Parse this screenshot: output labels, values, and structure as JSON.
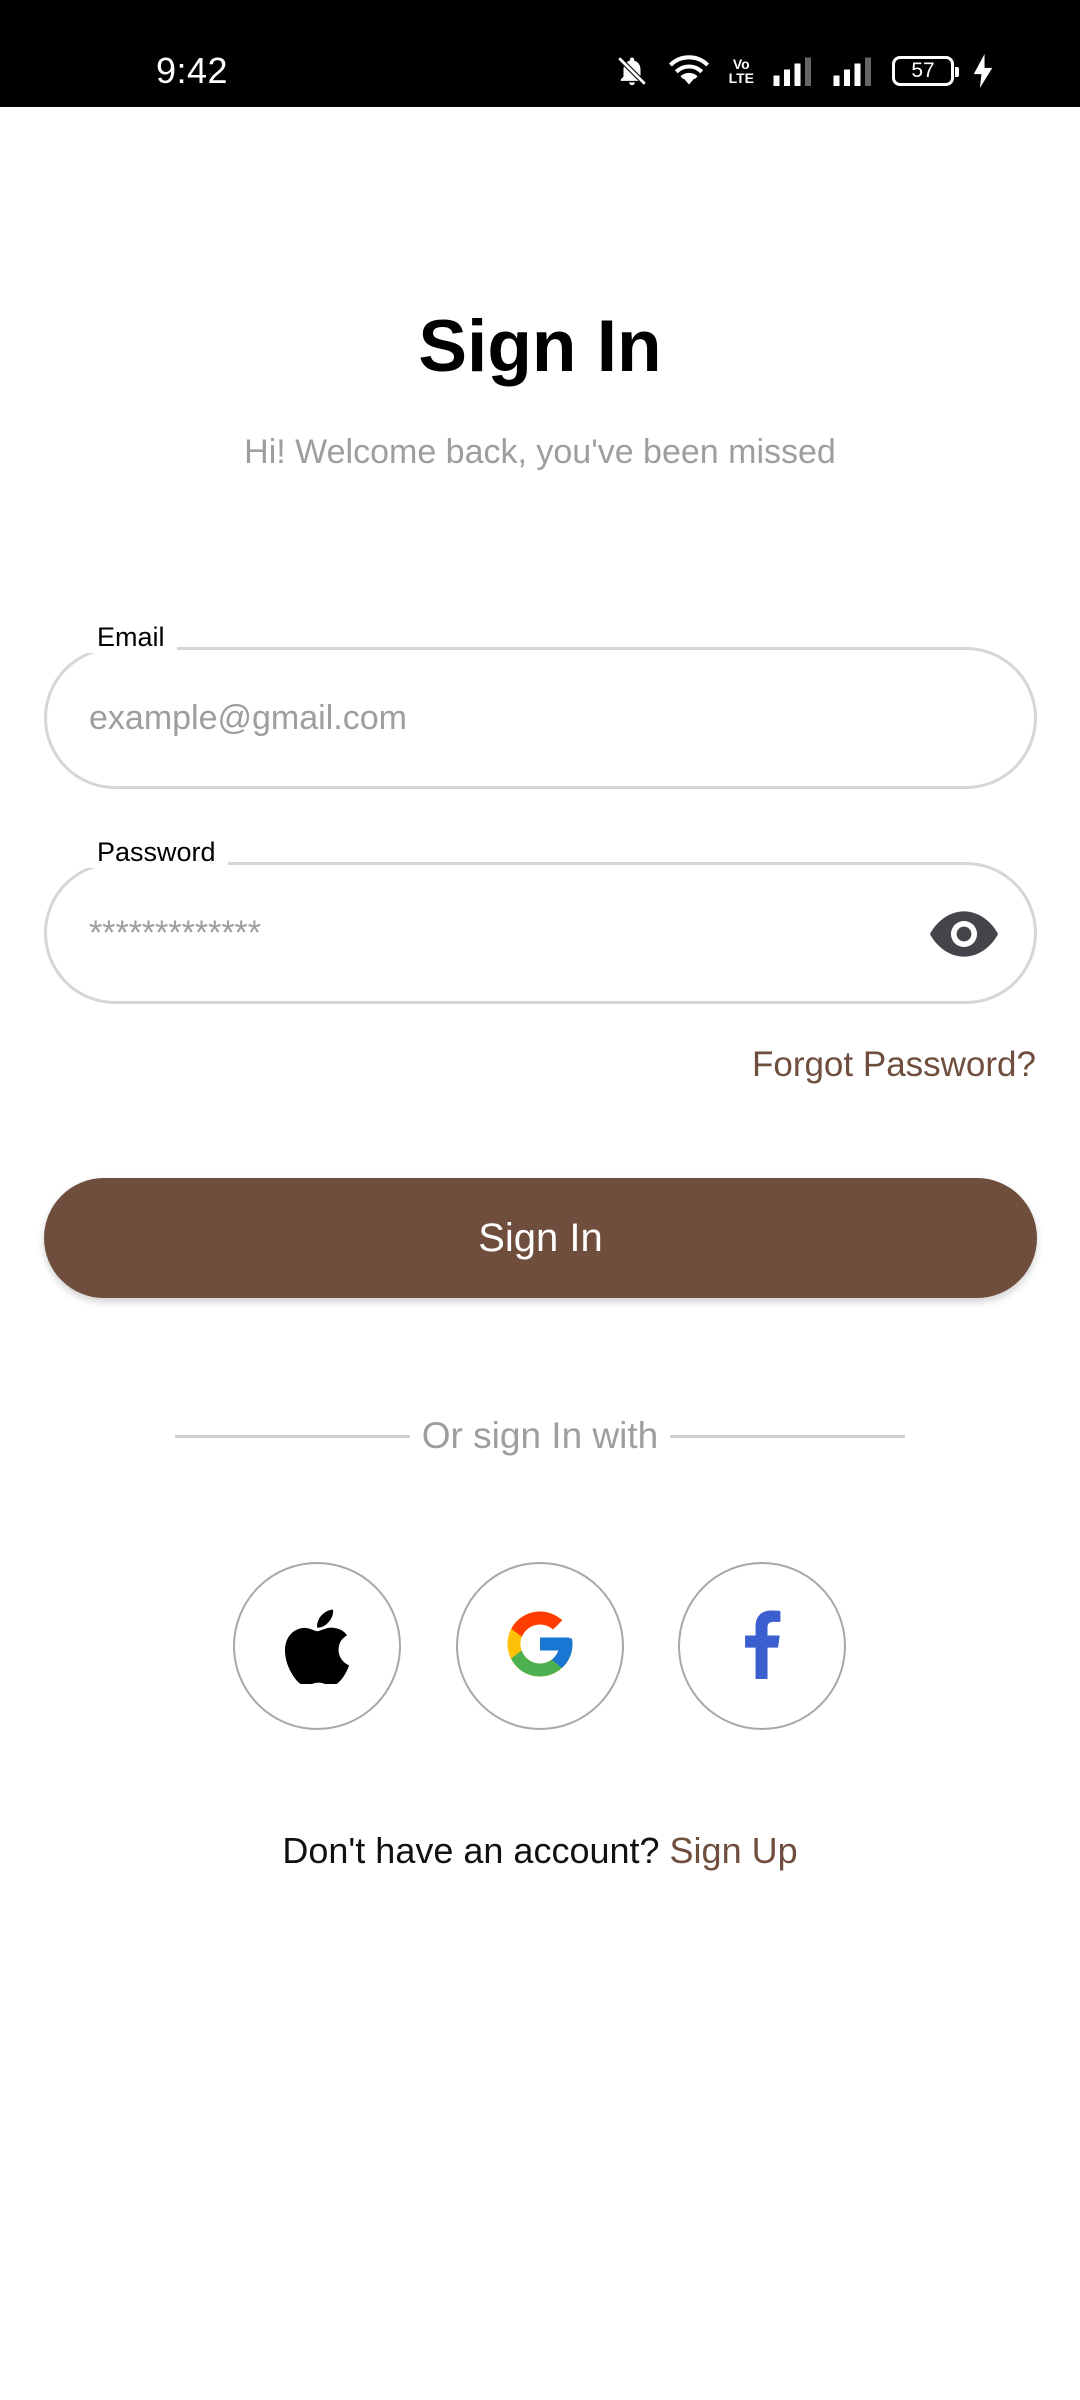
{
  "status_bar": {
    "time": "9:42",
    "network_badge_top": "Vo",
    "network_badge_bottom": "LTE",
    "battery_level": "57",
    "icons": [
      "mute-icon",
      "wifi-icon",
      "volte-icon",
      "signal-icon",
      "signal-icon",
      "battery-icon",
      "charging-icon"
    ]
  },
  "header": {
    "title": "Sign In",
    "subtitle": "Hi! Welcome back, you've been missed"
  },
  "form": {
    "email": {
      "label": "Email",
      "placeholder": "example@gmail.com",
      "value": ""
    },
    "password": {
      "label": "Password",
      "placeholder": "*************",
      "value": "",
      "visibility_icon": "eye-icon"
    },
    "forgot_password": "Forgot Password?",
    "submit_label": "Sign In"
  },
  "social": {
    "divider_text": "Or sign In with",
    "providers": [
      {
        "name": "Apple",
        "icon": "apple-icon"
      },
      {
        "name": "Google",
        "icon": "google-icon"
      },
      {
        "name": "Facebook",
        "icon": "facebook-icon"
      }
    ]
  },
  "footer": {
    "prompt": "Don't have an account?",
    "link": "Sign Up"
  },
  "colors": {
    "accent": "#6f4e3d",
    "muted_text": "#9e9e9e",
    "border": "#d6d6d6",
    "status_bar": "#000000"
  }
}
